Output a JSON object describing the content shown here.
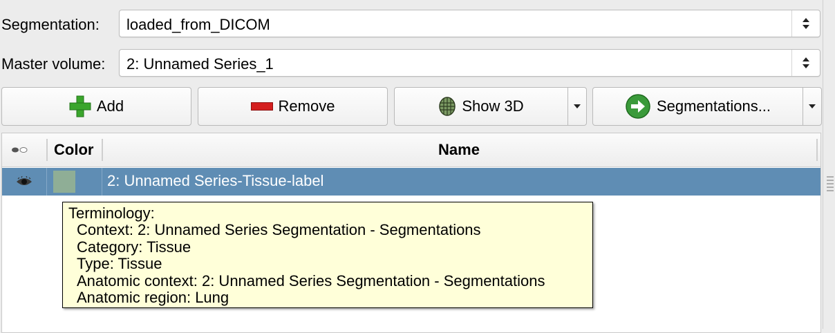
{
  "segmentation": {
    "label": "Segmentation:",
    "value": "loaded_from_DICOM"
  },
  "master_volume": {
    "label": "Master volume:",
    "value": "2: Unnamed Series_1"
  },
  "toolbar": {
    "add_label": "Add",
    "remove_label": "Remove",
    "show3d_label": "Show 3D",
    "segmentations_label": "Segmentations..."
  },
  "table": {
    "headers": {
      "visibility": "",
      "color": "Color",
      "name": "Name"
    },
    "rows": [
      {
        "name": "2: Unnamed Series-Tissue-label",
        "color": "#8fae96",
        "selected": true
      }
    ]
  },
  "tooltip": {
    "title": "Terminology:",
    "context": "Context: 2: Unnamed Series Segmentation - Segmentations",
    "category": "Category: Tissue",
    "type": "Type: Tissue",
    "anatomic_context": "Anatomic context: 2: Unnamed Series Segmentation - Segmentations",
    "anatomic_region": "Anatomic region: Lung"
  },
  "colors": {
    "selection": "#5f8db4",
    "tooltip_bg": "#ffffd9",
    "add_icon": "#3aa52c",
    "remove_icon": "#d41f1f"
  }
}
